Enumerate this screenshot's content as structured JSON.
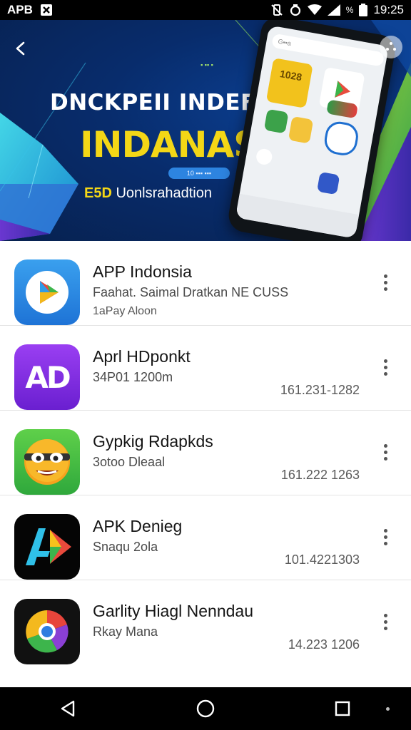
{
  "status_bar": {
    "carrier": "APB",
    "time": "19:25",
    "battery_text": "%"
  },
  "banner": {
    "title": "DNCKPEII INDEFYS",
    "headline": "INDANASIA",
    "subtitle_accent": "E5D",
    "subtitle": "Uonlsrahadtion",
    "chip_text": "10 ▪▪▪ ▪▪▪",
    "top_chip_text": "▪ ▪▪ ▪",
    "phone_tile_text": "1028",
    "phone_search_text": "G▪▪a"
  },
  "apps": [
    {
      "name": "APP Indonsia",
      "line1": "Faahat. Saimal Dratkan NE CUSS",
      "line2": "1aPay Aloon",
      "meta": "",
      "icon": "play-arrow-icon"
    },
    {
      "name": "Aprl HDponkt",
      "line1": "34P01 1200m",
      "line2": "",
      "meta": "161.231-1282",
      "icon": "ad-logo-icon",
      "icon_text": "AD"
    },
    {
      "name": "Gypkig Rdapkds",
      "line1": "3otoo Dleaal",
      "line2": "",
      "meta": "161.222 1263",
      "icon": "smiley-face-icon"
    },
    {
      "name": "APK Denieg",
      "line1": "Snaqu 2ola",
      "line2": "",
      "meta": "101.4221303",
      "icon": "triangle-logo-icon"
    },
    {
      "name": "Garlity Hiagl Nenndau",
      "line1": "Rkay Mana",
      "line2": "",
      "meta": "14.223 1206",
      "icon": "colorful-circle-icon"
    }
  ],
  "colors": {
    "accent_yellow": "#f4d716",
    "banner_blue": "#082c6c",
    "accent_green": "#86c232"
  }
}
